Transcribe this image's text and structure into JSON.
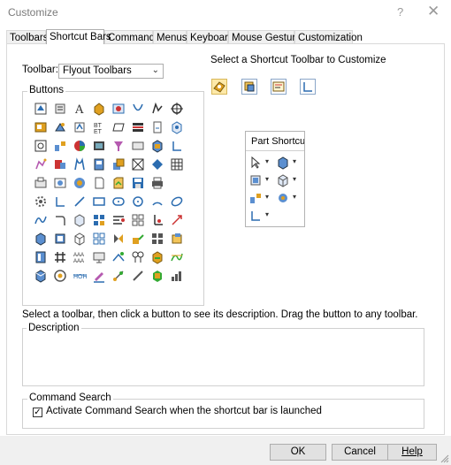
{
  "window": {
    "title": "Customize",
    "help_glyph": "?",
    "close_glyph": "✕"
  },
  "tabs": [
    {
      "label": "Toolbars"
    },
    {
      "label": "Shortcut Bars",
      "active": true
    },
    {
      "label": "Commands"
    },
    {
      "label": "Menus"
    },
    {
      "label": "Keyboard"
    },
    {
      "label": "Mouse Gestures"
    },
    {
      "label": "Customization"
    }
  ],
  "toolbar_selector": {
    "label": "Toolbar:",
    "value": "Flyout Toolbars"
  },
  "select_heading": "Select a Shortcut Toolbar to Customize",
  "shortcut_toolbar_buttons": [
    {
      "icon": "part-shortcut-toolbar-icon",
      "selected": true
    },
    {
      "icon": "assembly-shortcut-toolbar-icon",
      "selected": false
    },
    {
      "icon": "drawing-shortcut-toolbar-icon",
      "selected": false
    },
    {
      "icon": "sketch-shortcut-toolbar-icon",
      "selected": false
    }
  ],
  "buttons_group": {
    "label": "Buttons"
  },
  "flyout": {
    "title": "Part Shortcu...",
    "items": [
      {
        "icon": "select-arrow-icon"
      },
      {
        "icon": "view-orientation-icon"
      },
      {
        "icon": "display-style-icon"
      },
      {
        "icon": "appearance-icon"
      },
      {
        "icon": "reference-geometry-icon"
      },
      {
        "icon": "view-settings-icon"
      },
      {
        "icon": "sketch-icon"
      }
    ]
  },
  "instruction": "Select a toolbar, then click a button to see its description. Drag the button to any toolbar.",
  "description": {
    "label": "Description",
    "text": ""
  },
  "command_search": {
    "label": "Command Search",
    "checkbox_label": "Activate Command Search when the shortcut bar is launched",
    "checked": true
  },
  "footer": {
    "ok": "OK",
    "cancel": "Cancel",
    "help": "Help"
  },
  "colors": {
    "accent_blue": "#2b6cb0",
    "accent_orange": "#e0a020",
    "panel_border": "#d9d9d9"
  }
}
